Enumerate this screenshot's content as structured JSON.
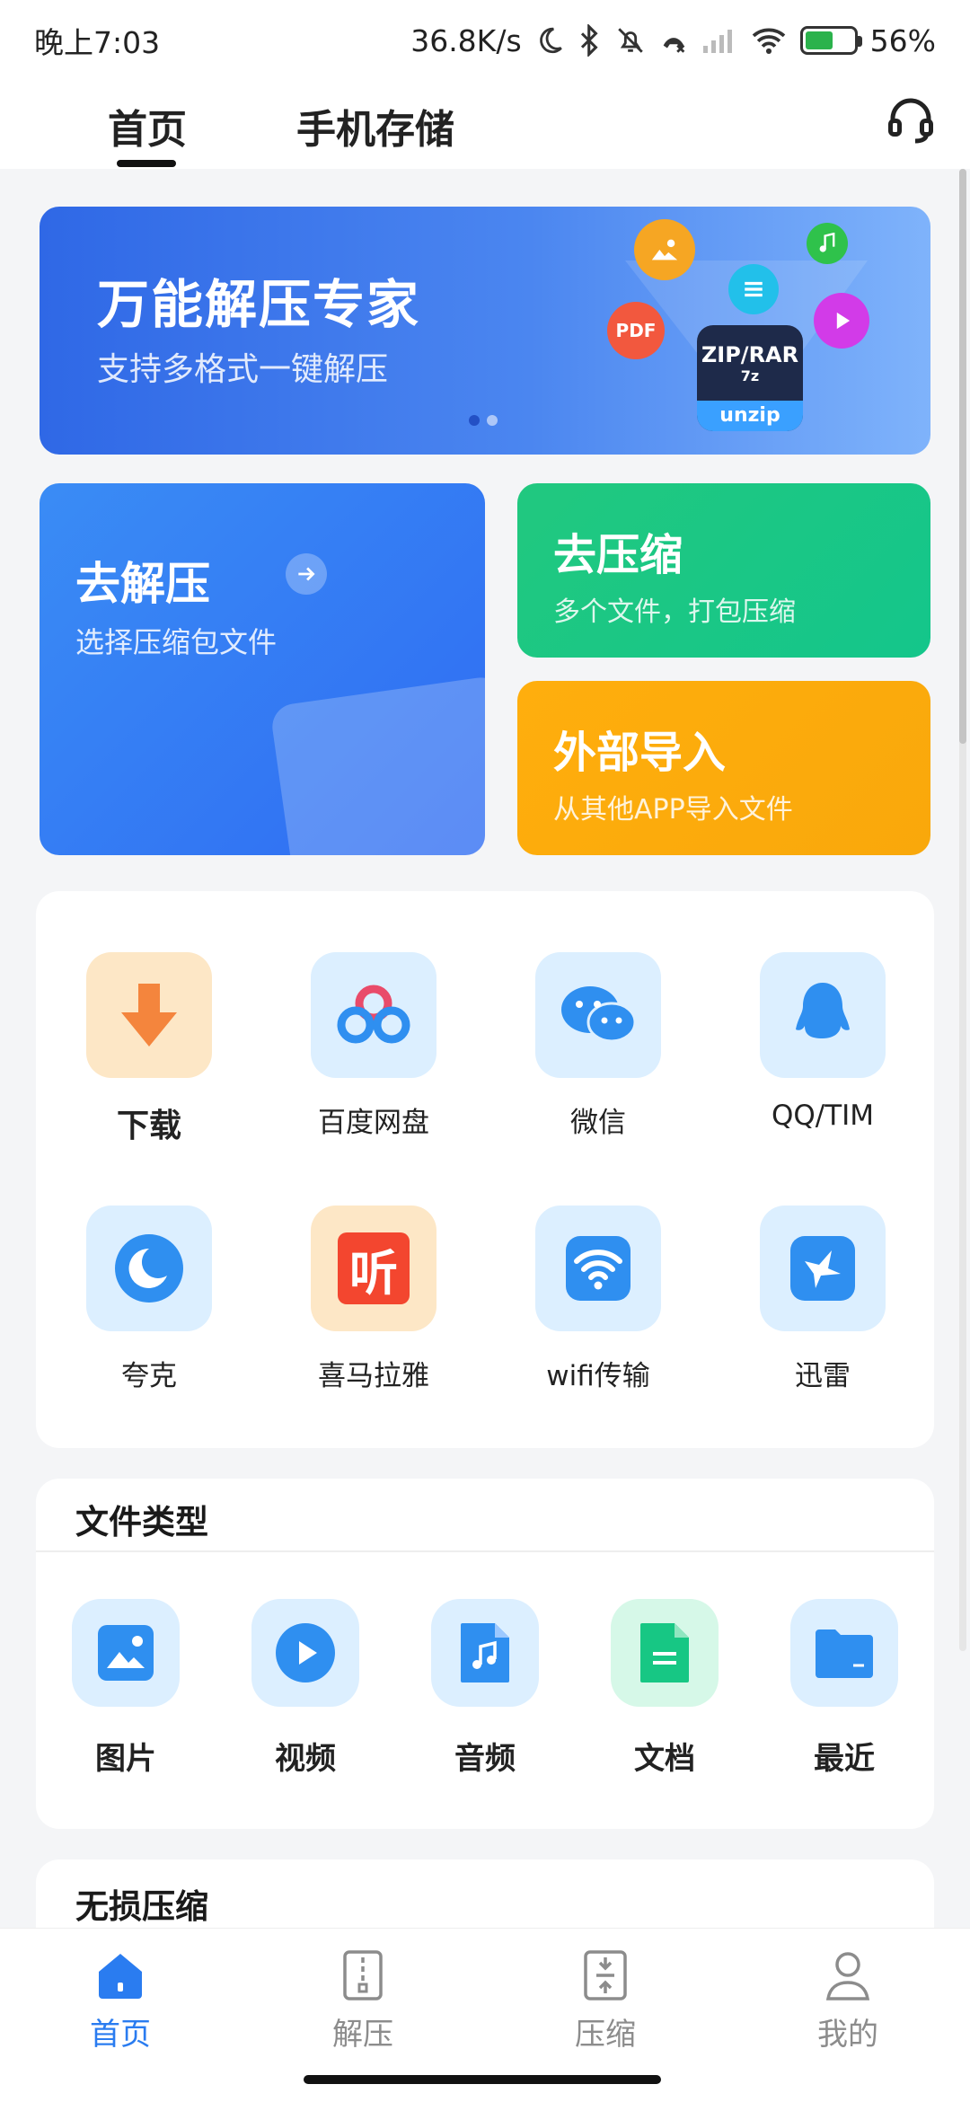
{
  "status_bar": {
    "time": "晚上7:03",
    "speed": "36.8K/s",
    "battery": "56%"
  },
  "top_nav": {
    "tabs": [
      {
        "label": "首页",
        "active": true
      },
      {
        "label": "手机存储",
        "active": false
      }
    ],
    "support_icon": "headset-icon"
  },
  "banner": {
    "title": "万能解压专家",
    "subtitle": "支持多格式一键解压",
    "zip_label": "ZIP/RAR",
    "seven_z": "7z",
    "unzip": "unzip",
    "pdf_label": "PDF",
    "page_count": 2,
    "active_page": 1
  },
  "actions": {
    "decompress": {
      "title": "去解压",
      "subtitle": "选择压缩包文件"
    },
    "compress": {
      "title": "去压缩",
      "subtitle": "多个文件，打包压缩"
    },
    "import": {
      "title": "外部导入",
      "subtitle": "从其他APP导入文件"
    }
  },
  "sources": [
    {
      "label": "下载",
      "icon": "download-icon"
    },
    {
      "label": "百度网盘",
      "icon": "baidu-netdisk-icon"
    },
    {
      "label": "微信",
      "icon": "wechat-icon"
    },
    {
      "label": "QQ/TIM",
      "icon": "qq-icon"
    },
    {
      "label": "夸克",
      "icon": "quark-icon"
    },
    {
      "label": "喜马拉雅",
      "icon": "ximalaya-icon"
    },
    {
      "label": "wifi传输",
      "icon": "wifi-transfer-icon"
    },
    {
      "label": "迅雷",
      "icon": "xunlei-icon"
    }
  ],
  "ximalaya_glyph": "听",
  "file_types": {
    "header": "文件类型",
    "items": [
      {
        "label": "图片",
        "icon": "image-icon"
      },
      {
        "label": "视频",
        "icon": "video-icon"
      },
      {
        "label": "音频",
        "icon": "audio-icon"
      },
      {
        "label": "文档",
        "icon": "document-icon"
      },
      {
        "label": "最近",
        "icon": "recent-folder-icon"
      }
    ]
  },
  "lossless": {
    "header": "无损压缩"
  },
  "bottom_nav": [
    {
      "label": "首页",
      "icon": "home-icon",
      "active": true
    },
    {
      "label": "解压",
      "icon": "decompress-icon",
      "active": false
    },
    {
      "label": "压缩",
      "icon": "compress-icon",
      "active": false
    },
    {
      "label": "我的",
      "icon": "profile-icon",
      "active": false
    }
  ],
  "colors": {
    "primary": "#2a7cf0",
    "compress_green": "#17c784",
    "import_orange": "#fbab0c"
  }
}
